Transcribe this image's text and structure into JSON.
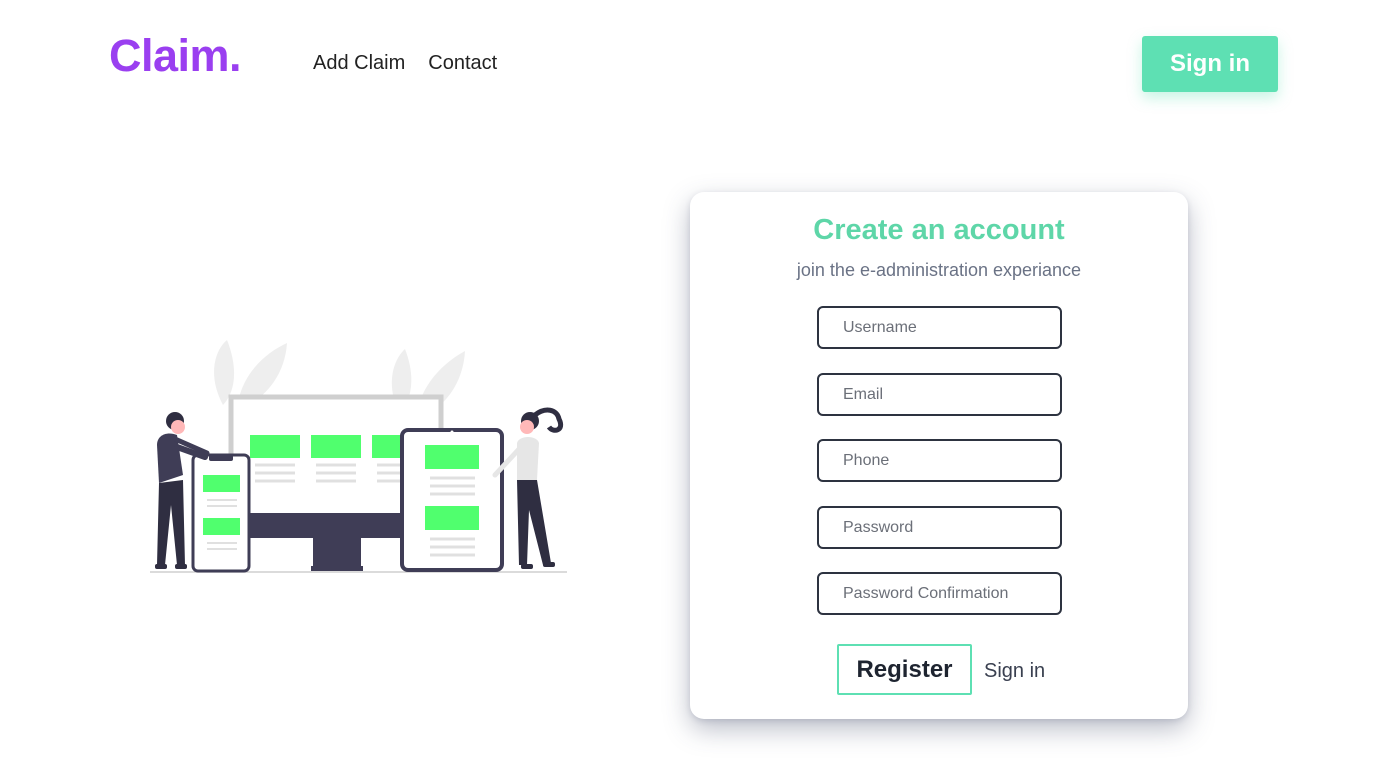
{
  "header": {
    "logo": "Claim.",
    "nav": [
      "Add Claim",
      "Contact"
    ],
    "signin_label": "Sign in"
  },
  "colors": {
    "brand_purple": "#9a3ff0",
    "accent_green": "#5ee0b3",
    "illustration_green": "#50ff6e",
    "dark": "#2d3340"
  },
  "card": {
    "title": "Create an account",
    "subtitle": "join the e-administration experiance",
    "fields": [
      {
        "placeholder": "Username",
        "value": ""
      },
      {
        "placeholder": "Email",
        "value": ""
      },
      {
        "placeholder": "Phone",
        "value": ""
      },
      {
        "placeholder": "Password",
        "value": ""
      },
      {
        "placeholder": "Password Confirmation",
        "value": ""
      }
    ],
    "register_label": "Register",
    "signin_label": "Sign in"
  }
}
